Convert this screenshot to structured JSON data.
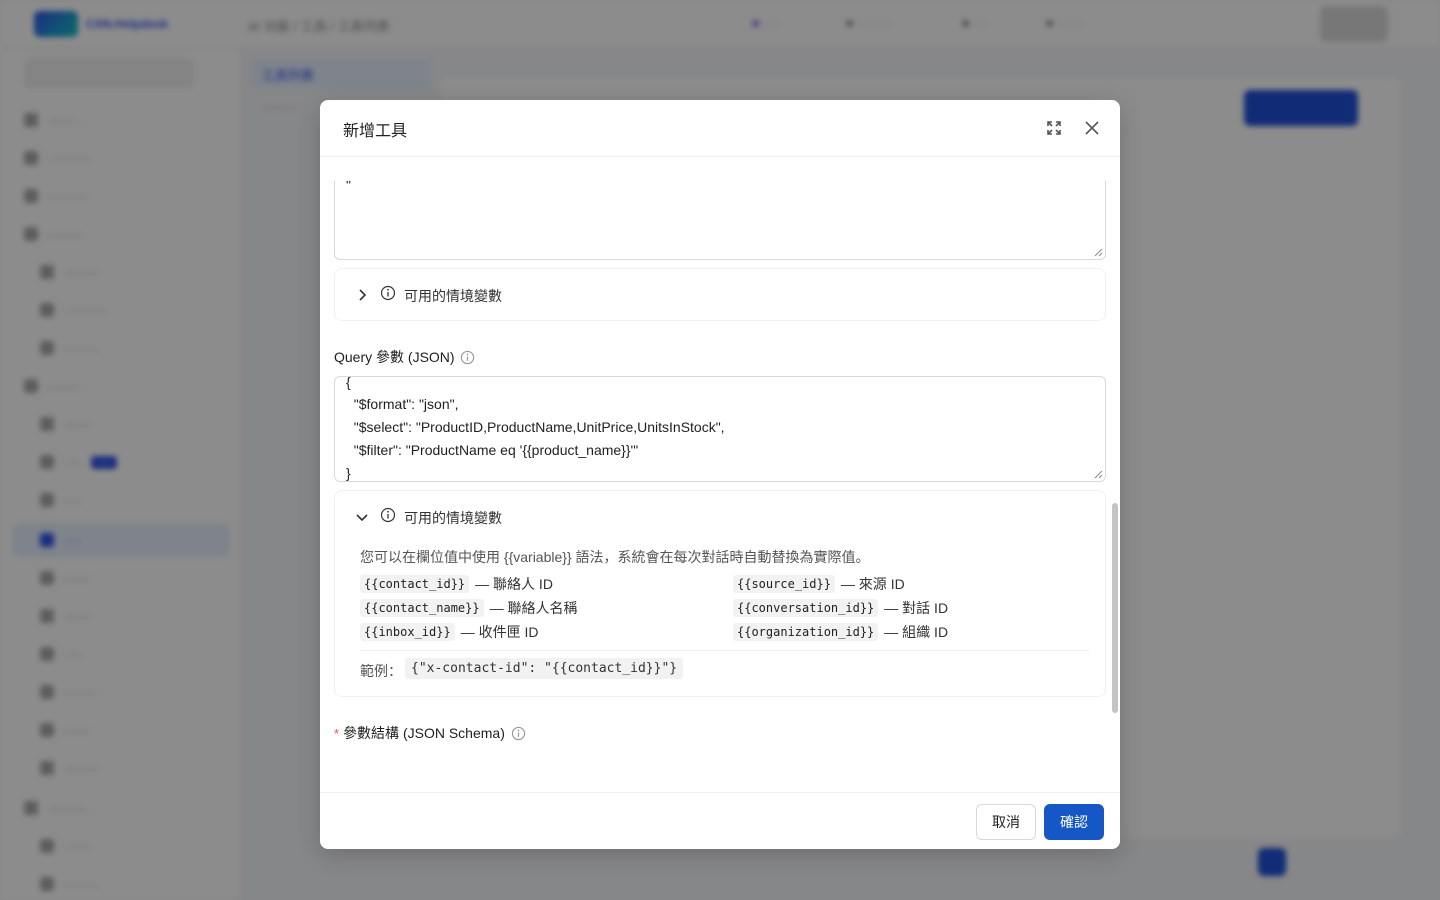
{
  "modal": {
    "title": "新增工具",
    "body_textarea_top_partial": "\"",
    "context_vars_collapsed_title": "可用的情境變數",
    "query_params": {
      "label": "Query 參數 (JSON)",
      "lines": [
        "{",
        "  \"$format\": \"json\",",
        "  \"$select\": \"ProductID,ProductName,UnitPrice,UnitsInStock\",",
        "  \"$filter\": \"ProductName eq '{{product_name}}'\"",
        "}"
      ]
    },
    "context_vars_expanded": {
      "title": "可用的情境變數",
      "help": "您可以在欄位值中使用 {{variable}} 語法，系統會在每次對話時自動替換為實際值。",
      "variables": [
        {
          "code": "{{contact_id}}",
          "desc": "— 聯絡人 ID"
        },
        {
          "code": "{{source_id}}",
          "desc": "— 來源 ID"
        },
        {
          "code": "{{contact_name}}",
          "desc": "— 聯絡人名稱"
        },
        {
          "code": "{{conversation_id}}",
          "desc": "— 對話 ID"
        },
        {
          "code": "{{inbox_id}}",
          "desc": "— 收件匣 ID"
        },
        {
          "code": "{{organization_id}}",
          "desc": "— 組織 ID"
        }
      ],
      "example_label": "範例：",
      "example_code": "{\"x-contact-id\": \"{{contact_id}}\"}"
    },
    "schema_label": "參數結構 (JSON Schema)",
    "schema_required_mark": "*",
    "footer": {
      "cancel_label": "取消",
      "ok_label": "確認"
    }
  },
  "background": {
    "logo_text": "CXN.Helpdesk",
    "breadcrumb": "AI 功能  /  工具  /  工具列表",
    "tab_active": "工具列表",
    "colors": {
      "accent": "#1557c4",
      "overlay": "rgba(0,0,0,0.45)"
    }
  }
}
